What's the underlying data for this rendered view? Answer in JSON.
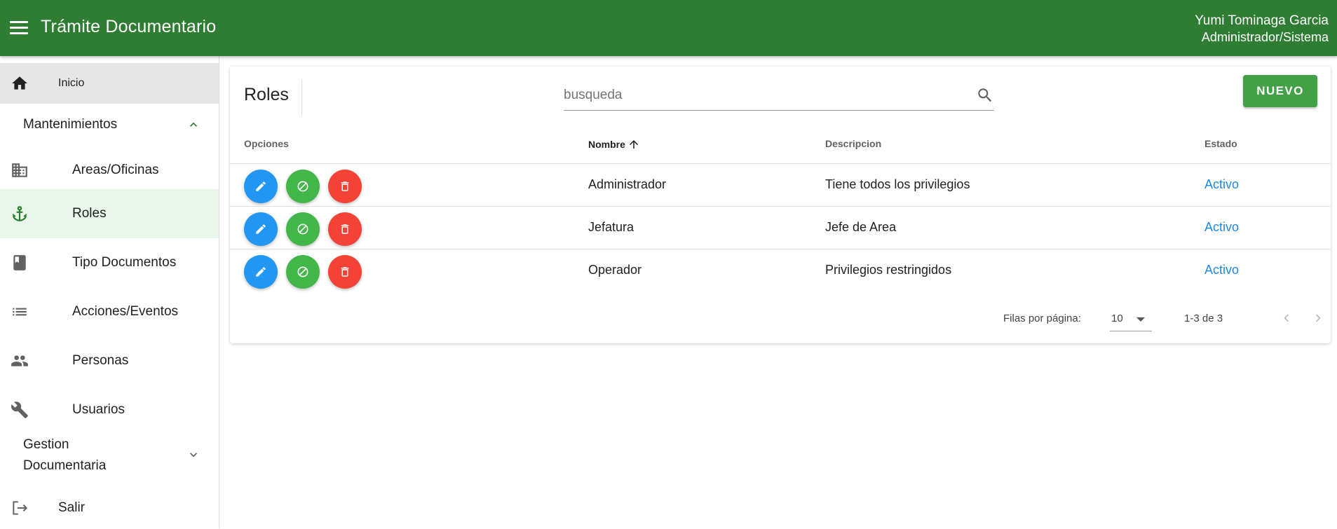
{
  "appbar": {
    "title": "Trámite Documentario",
    "user_name": "Yumi Tominaga Garcia",
    "user_role": "Administrador/Sistema",
    "color": "#2e7d32"
  },
  "sidebar": {
    "home": {
      "label": "Inicio",
      "icon": "home-icon"
    },
    "group": {
      "label": "Mantenimientos",
      "icon": "chevron-up-icon"
    },
    "items": [
      {
        "label": "Areas/Oficinas",
        "icon": "building-icon"
      },
      {
        "label": "Roles",
        "icon": "anchor-icon",
        "active": true
      },
      {
        "label": "Tipo Documentos",
        "icon": "book-icon"
      },
      {
        "label": "Acciones/Eventos",
        "icon": "list-icon"
      },
      {
        "label": "Personas",
        "icon": "people-icon"
      },
      {
        "label": "Usuarios",
        "icon": "wrench-icon"
      }
    ],
    "gestion": {
      "label_line1": "Gestion",
      "label_line2": "Documentaria",
      "icon": "chevron-down-icon"
    },
    "salir": {
      "label": "Salir",
      "icon": "logout-icon"
    }
  },
  "card": {
    "title": "Roles",
    "search_placeholder": "busqueda",
    "new_button": "NUEVO",
    "headers": {
      "opciones": "Opciones",
      "nombre": "Nombre",
      "descripcion": "Descripcion",
      "estado": "Estado"
    },
    "rows": [
      {
        "nombre": "Administrador",
        "descripcion": "Tiene todos los privilegios",
        "estado": "Activo"
      },
      {
        "nombre": "Jefatura",
        "descripcion": "Jefe de Area",
        "estado": "Activo"
      },
      {
        "nombre": "Operador",
        "descripcion": "Privilegios restringidos",
        "estado": "Activo"
      }
    ],
    "footer": {
      "rows_per_page_label": "Filas por página:",
      "rows_per_page": "10",
      "range": "1-3 de 3"
    }
  }
}
